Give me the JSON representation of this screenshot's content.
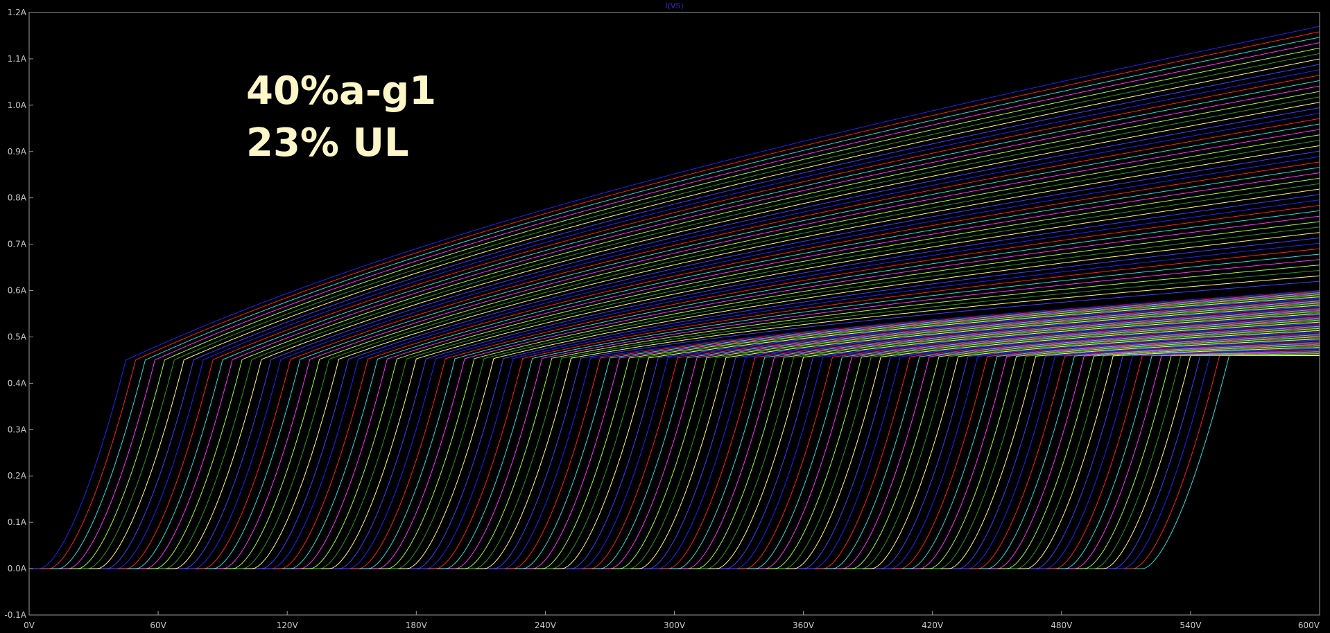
{
  "chart_data": {
    "type": "line",
    "title": "I(VS)",
    "xlabel": "",
    "ylabel": "",
    "xlim": [
      0,
      600
    ],
    "ylim": [
      -0.1,
      1.2
    ],
    "x_ticks": [
      {
        "value": 0,
        "label": "0V"
      },
      {
        "value": 60,
        "label": "60V"
      },
      {
        "value": 120,
        "label": "120V"
      },
      {
        "value": 180,
        "label": "180V"
      },
      {
        "value": 240,
        "label": "240V"
      },
      {
        "value": 300,
        "label": "300V"
      },
      {
        "value": 360,
        "label": "360V"
      },
      {
        "value": 420,
        "label": "420V"
      },
      {
        "value": 480,
        "label": "480V"
      },
      {
        "value": 540,
        "label": "540V"
      },
      {
        "value": 600,
        "label": "600V"
      }
    ],
    "y_ticks": [
      {
        "value": 1.2,
        "label": "1.2A"
      },
      {
        "value": 1.1,
        "label": "1.1A"
      },
      {
        "value": 1.0,
        "label": "1.0A"
      },
      {
        "value": 0.9,
        "label": "0.9A"
      },
      {
        "value": 0.8,
        "label": "0.8A"
      },
      {
        "value": 0.7,
        "label": "0.7A"
      },
      {
        "value": 0.6,
        "label": "0.6A"
      },
      {
        "value": 0.5,
        "label": "0.5A"
      },
      {
        "value": 0.4,
        "label": "0.4A"
      },
      {
        "value": 0.3,
        "label": "0.3A"
      },
      {
        "value": 0.2,
        "label": "0.2A"
      },
      {
        "value": 0.1,
        "label": "0.1A"
      },
      {
        "value": 0.0,
        "label": "0.0A"
      },
      {
        "value": -0.1,
        "label": "-0.1A"
      }
    ],
    "grid": false,
    "legend": "none",
    "colors": [
      "#2222ff",
      "#ff2020",
      "#20e0e0",
      "#ff30ff",
      "#a0ff30",
      "#20a020",
      "#ffff60",
      "#4040ff"
    ],
    "annotations": [
      "40%a-g1",
      "23% UL"
    ],
    "family": {
      "count": 115,
      "onset_start": 5,
      "onset_step": 4.5,
      "rise_voltage": 40,
      "knee_current_start": 0.45,
      "knee_current_end": 0.46,
      "top_current_start": 1.17,
      "top_current_end": 0.45,
      "top_saturated_count": 48
    }
  }
}
